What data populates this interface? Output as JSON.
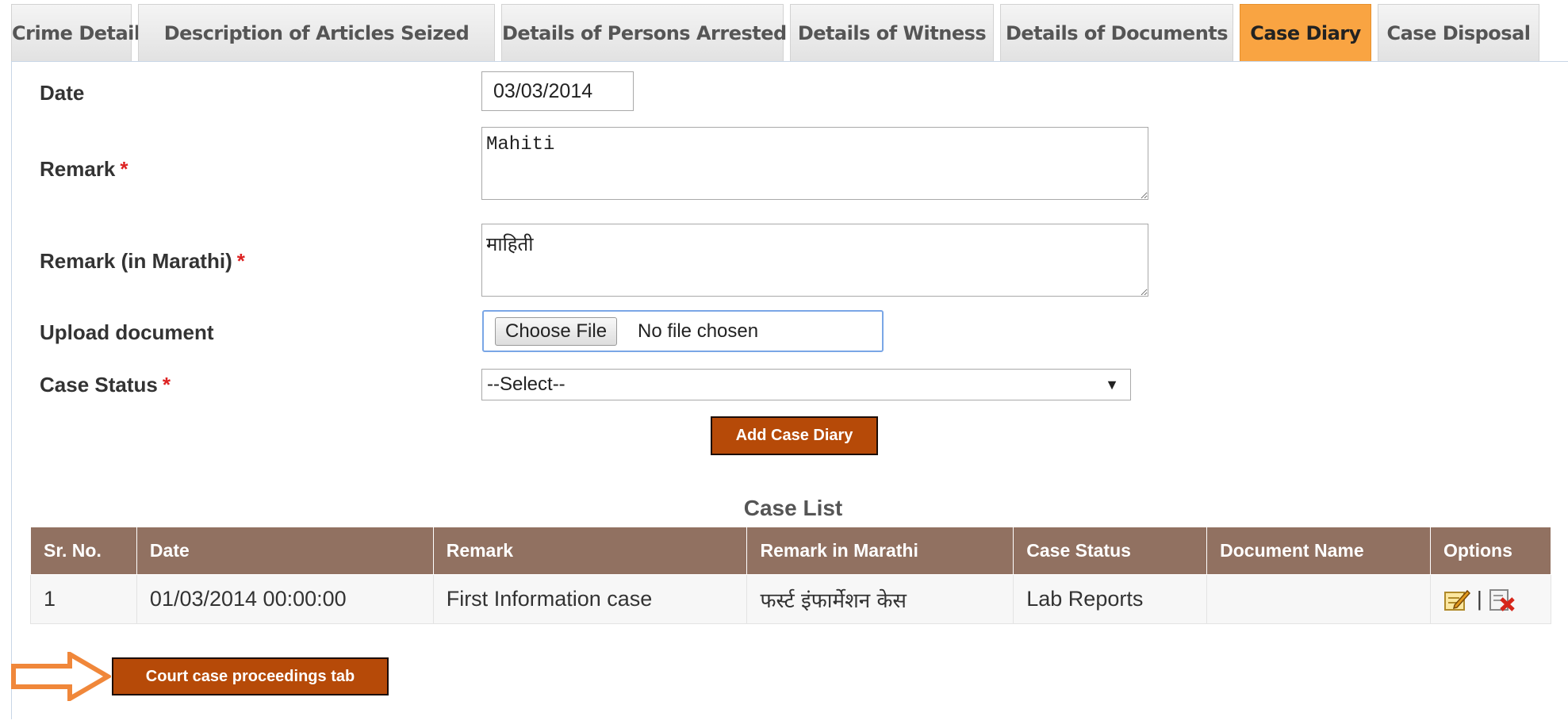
{
  "tabs": [
    {
      "label": "Crime Details"
    },
    {
      "label": "Description of Articles Seized"
    },
    {
      "label": "Details of Persons Arrested"
    },
    {
      "label": "Details of Witness"
    },
    {
      "label": "Details of Documents"
    },
    {
      "label": "Case Diary",
      "active": true
    },
    {
      "label": "Case Disposal"
    }
  ],
  "form": {
    "date_label": "Date",
    "date_value": "03/03/2014",
    "remark_label": "Remark",
    "remark_value": "Mahiti",
    "remark_marathi_label": "Remark (in Marathi)",
    "remark_marathi_value": "माहिती",
    "upload_label": "Upload document",
    "choose_file_label": "Choose File",
    "no_file_text": "No file chosen",
    "case_status_label": "Case Status",
    "case_status_selected": "--Select--",
    "required_mark": "*",
    "add_button": "Add Case Diary"
  },
  "case_list": {
    "title": "Case List",
    "columns": [
      "Sr. No.",
      "Date",
      "Remark",
      "Remark in Marathi",
      "Case Status",
      "Document Name",
      "Options"
    ],
    "rows": [
      {
        "sr": "1",
        "date": "01/03/2014 00:00:00",
        "remark": "First Information case",
        "remark_marathi": "फर्स्ट इंफार्मेशन केस",
        "status": "Lab Reports",
        "document": "",
        "separator": "|"
      }
    ]
  },
  "callout": {
    "button_label": "Court case proceedings tab",
    "arrow_color": "#f0873a"
  },
  "colors": {
    "accent_tab": "#f9a442",
    "button_brown": "#b64a08",
    "table_header": "#917161",
    "required": "#dd2222"
  }
}
